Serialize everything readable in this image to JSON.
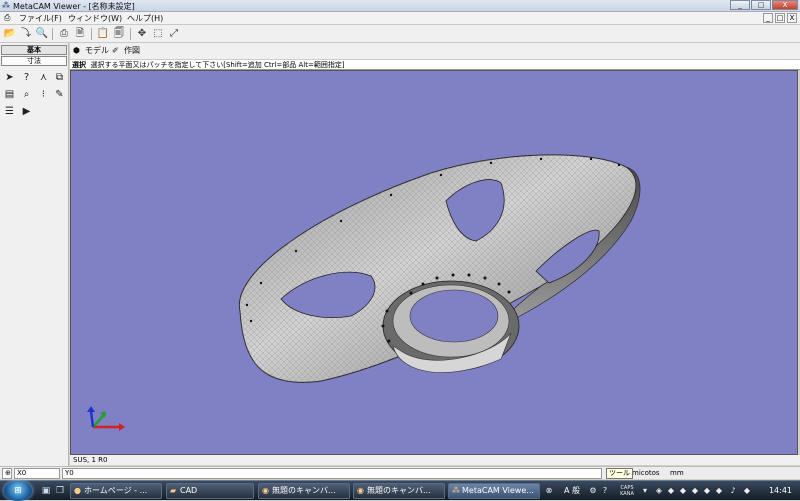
{
  "window": {
    "title": "MetaCAM Viewer - [名称未設定]",
    "app_icon": "meta-icon"
  },
  "window_buttons": [
    "_",
    "□",
    "X"
  ],
  "menu": {
    "items": [
      "ファイル(F)",
      "ウィンドウ(W)",
      "ヘルプ(H)"
    ]
  },
  "mdi_buttons": [
    "_",
    "□",
    "X"
  ],
  "toolbar": {
    "icons": [
      "open-icon",
      "import-icon",
      "search-file-icon",
      "print-icon",
      "print-preview-icon",
      "clipboard-icon",
      "document-icon",
      "pan-icon",
      "zoom-window-icon",
      "zoom-fit-icon"
    ]
  },
  "left_panel": {
    "tabs": [
      "基本",
      "寸法"
    ],
    "tools": [
      "select-arrow-icon",
      "query-icon",
      "measure-icon",
      "layer-icon",
      "display-icon",
      "magnify-icon",
      "grid-icon",
      "note-icon",
      "stack-icon",
      "play-icon"
    ]
  },
  "view_tabs": [
    {
      "label": "モデル"
    },
    {
      "label": "作図"
    }
  ],
  "prompt": {
    "mode": "選択",
    "text": "選択する平面又はパッチを指定して下さい[Shift=追加 Ctrl=部品 Alt=範囲指定]"
  },
  "material_label": "SUS, 1 R0",
  "coords": {
    "x": "X0",
    "y": "Y0"
  },
  "status_right": {
    "tooltip": "ツール",
    "partial": "micotos",
    "unit": "mm"
  },
  "taskbar": {
    "buttons": [
      {
        "label": "ホームページ - ..."
      },
      {
        "label": "CAD"
      },
      {
        "label": "無題のキャンバ..."
      },
      {
        "label": "無題のキャンバ..."
      },
      {
        "label": "MetaCAM Viewe..."
      }
    ],
    "ime": "A 般",
    "caps": "CAPS KANA",
    "time": "14:41"
  },
  "colors": {
    "viewport": "#8080c4",
    "model": "#c9c9c9",
    "axis_x": "#d32020",
    "axis_y": "#22a02a",
    "axis_z": "#2030d0"
  }
}
